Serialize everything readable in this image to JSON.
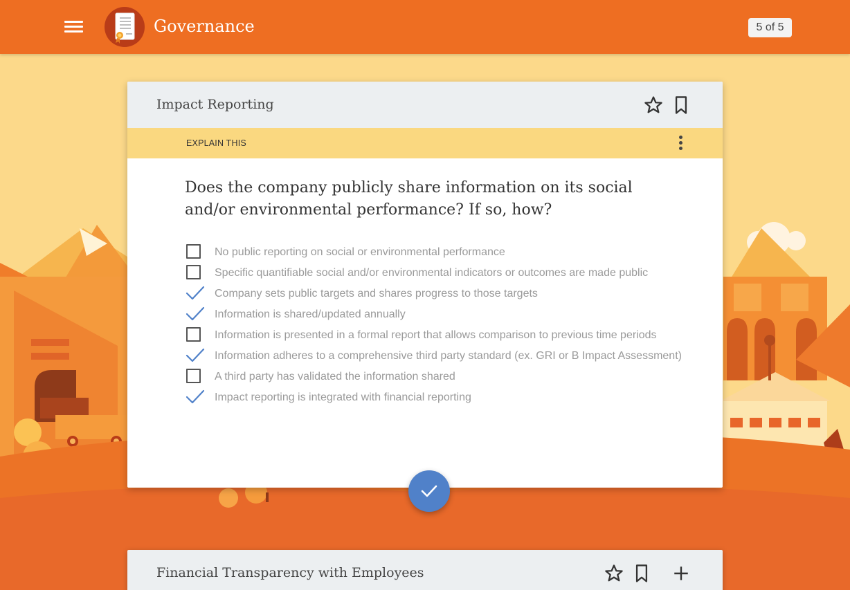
{
  "topbar": {
    "menu_icon": "hamburger-menu-icon",
    "logo_icon": "certificate-document-icon",
    "title": "Governance",
    "counter": "5 of 5",
    "color": "#ee6e22"
  },
  "card": {
    "title": "Impact Reporting",
    "header_icons": [
      "star-outline-icon",
      "bookmark-outline-icon"
    ],
    "explain_label": "EXPLAIN THIS",
    "more_icon": "more-vertical-icon",
    "question": "Does the company publicly share information on its social and/or environmental performance? If so, how?",
    "options": [
      {
        "label": "No public reporting on social or environmental performance",
        "checked": false
      },
      {
        "label": "Specific quantifiable social and/or environmental indicators or outcomes are made public",
        "checked": false
      },
      {
        "label": "Company sets public targets and shares progress to those targets",
        "checked": true
      },
      {
        "label": "Information is shared/updated annually",
        "checked": true
      },
      {
        "label": "Information is presented in a formal report that allows comparison to previous time periods",
        "checked": false
      },
      {
        "label": "Information adheres to a comprehensive third party standard (ex. GRI or B Impact Assessment)",
        "checked": true
      },
      {
        "label": "A third party has validated the information shared",
        "checked": false
      },
      {
        "label": "Impact reporting is integrated with financial reporting",
        "checked": true
      }
    ],
    "check_color": "#5081c9"
  },
  "submit": {
    "icon": "checkmark-icon",
    "color": "#5081c9"
  },
  "next_card": {
    "title": "Financial Transparency with Employees",
    "icons": [
      "star-outline-icon",
      "bookmark-outline-icon",
      "plus-icon"
    ]
  }
}
